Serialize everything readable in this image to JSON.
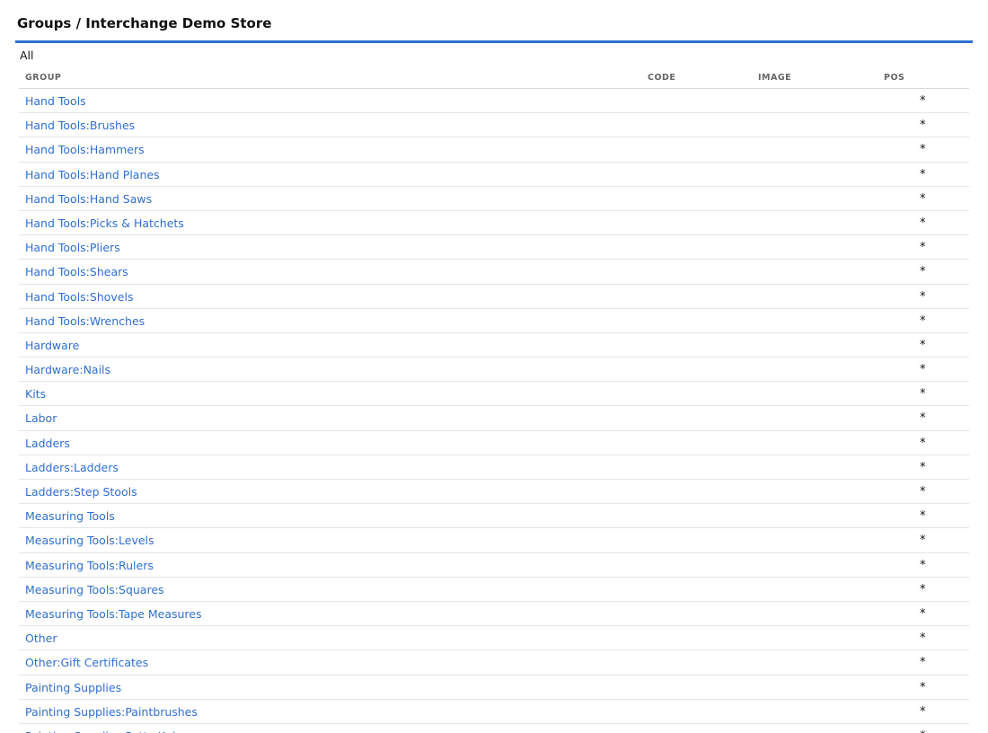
{
  "header": {
    "title": "Groups / Interchange Demo Store",
    "accent_color": "#2f6fd0"
  },
  "filter": {
    "all_label": "All"
  },
  "table": {
    "columns": {
      "group": "GROUP",
      "code": "CODE",
      "image": "IMAGE",
      "pos": "POS"
    },
    "rows": [
      {
        "group": "Hand Tools",
        "code": "",
        "image": "",
        "pos": "*"
      },
      {
        "group": "Hand Tools:Brushes",
        "code": "",
        "image": "",
        "pos": "*"
      },
      {
        "group": "Hand Tools:Hammers",
        "code": "",
        "image": "",
        "pos": "*"
      },
      {
        "group": "Hand Tools:Hand Planes",
        "code": "",
        "image": "",
        "pos": "*"
      },
      {
        "group": "Hand Tools:Hand Saws",
        "code": "",
        "image": "",
        "pos": "*"
      },
      {
        "group": "Hand Tools:Picks & Hatchets",
        "code": "",
        "image": "",
        "pos": "*"
      },
      {
        "group": "Hand Tools:Pliers",
        "code": "",
        "image": "",
        "pos": "*"
      },
      {
        "group": "Hand Tools:Shears",
        "code": "",
        "image": "",
        "pos": "*"
      },
      {
        "group": "Hand Tools:Shovels",
        "code": "",
        "image": "",
        "pos": "*"
      },
      {
        "group": "Hand Tools:Wrenches",
        "code": "",
        "image": "",
        "pos": "*"
      },
      {
        "group": "Hardware",
        "code": "",
        "image": "",
        "pos": "*"
      },
      {
        "group": "Hardware:Nails",
        "code": "",
        "image": "",
        "pos": "*"
      },
      {
        "group": "Kits",
        "code": "",
        "image": "",
        "pos": "*"
      },
      {
        "group": "Labor",
        "code": "",
        "image": "",
        "pos": "*"
      },
      {
        "group": "Ladders",
        "code": "",
        "image": "",
        "pos": "*"
      },
      {
        "group": "Ladders:Ladders",
        "code": "",
        "image": "",
        "pos": "*"
      },
      {
        "group": "Ladders:Step Stools",
        "code": "",
        "image": "",
        "pos": "*"
      },
      {
        "group": "Measuring Tools",
        "code": "",
        "image": "",
        "pos": "*"
      },
      {
        "group": "Measuring Tools:Levels",
        "code": "",
        "image": "",
        "pos": "*"
      },
      {
        "group": "Measuring Tools:Rulers",
        "code": "",
        "image": "",
        "pos": "*"
      },
      {
        "group": "Measuring Tools:Squares",
        "code": "",
        "image": "",
        "pos": "*"
      },
      {
        "group": "Measuring Tools:Tape Measures",
        "code": "",
        "image": "",
        "pos": "*"
      },
      {
        "group": "Other",
        "code": "",
        "image": "",
        "pos": "*"
      },
      {
        "group": "Other:Gift Certificates",
        "code": "",
        "image": "",
        "pos": "*"
      },
      {
        "group": "Painting Supplies",
        "code": "",
        "image": "",
        "pos": "*"
      },
      {
        "group": "Painting Supplies:Paintbrushes",
        "code": "",
        "image": "",
        "pos": "*"
      },
      {
        "group": "Painting Supplies:Putty Knives",
        "code": "",
        "image": "",
        "pos": "*"
      }
    ]
  }
}
